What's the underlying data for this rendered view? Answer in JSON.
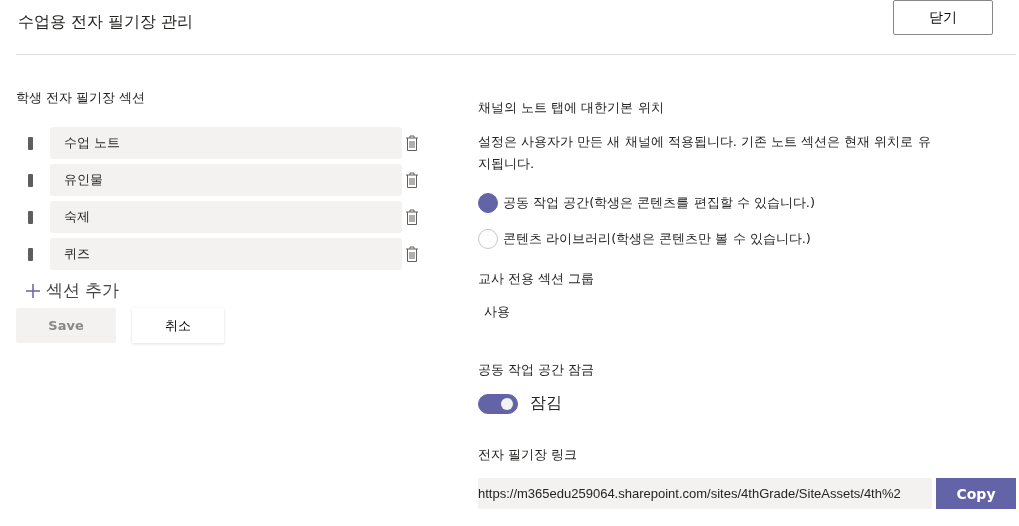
{
  "header": {
    "title": "수업용 전자 필기장 관리",
    "close_button": "닫기"
  },
  "sections": {
    "title": "학생 전자 필기장 섹션",
    "items": [
      {
        "name": "수업 노트"
      },
      {
        "name": "유인물"
      },
      {
        "name": "숙제"
      },
      {
        "name": "퀴즈"
      }
    ],
    "add_label": "섹션 추가",
    "save": {
      "label": "Save",
      "disabled": true
    },
    "cancel": "취소"
  },
  "default_location": {
    "title": "채널의 노트 탭에 대한기본 위치",
    "description": "설정은 사용자가 만든 새 채널에 적용됩니다. 기존 노트 섹션은 현재 위치로 유지됩니다.",
    "options": [
      {
        "label": "공동 작업 공간(학생은 콘텐츠를 편집할 수 있습니다.)",
        "selected": true
      },
      {
        "label": "콘텐츠 라이브러리(학생은 콘텐츠만 볼 수 있습니다.)",
        "selected": false
      }
    ]
  },
  "teacher_group": {
    "title": "교사 전용 섹션 그룹",
    "value": "사용"
  },
  "lock": {
    "title": "공동 작업 공간 잠금",
    "on": true,
    "label": "잠김"
  },
  "link": {
    "title": "전자 필기장 링크",
    "value": "https://m365edu259064.sharepoint.com/sites/4thGrade/SiteAssets/4th%2",
    "copy": "Copy"
  }
}
